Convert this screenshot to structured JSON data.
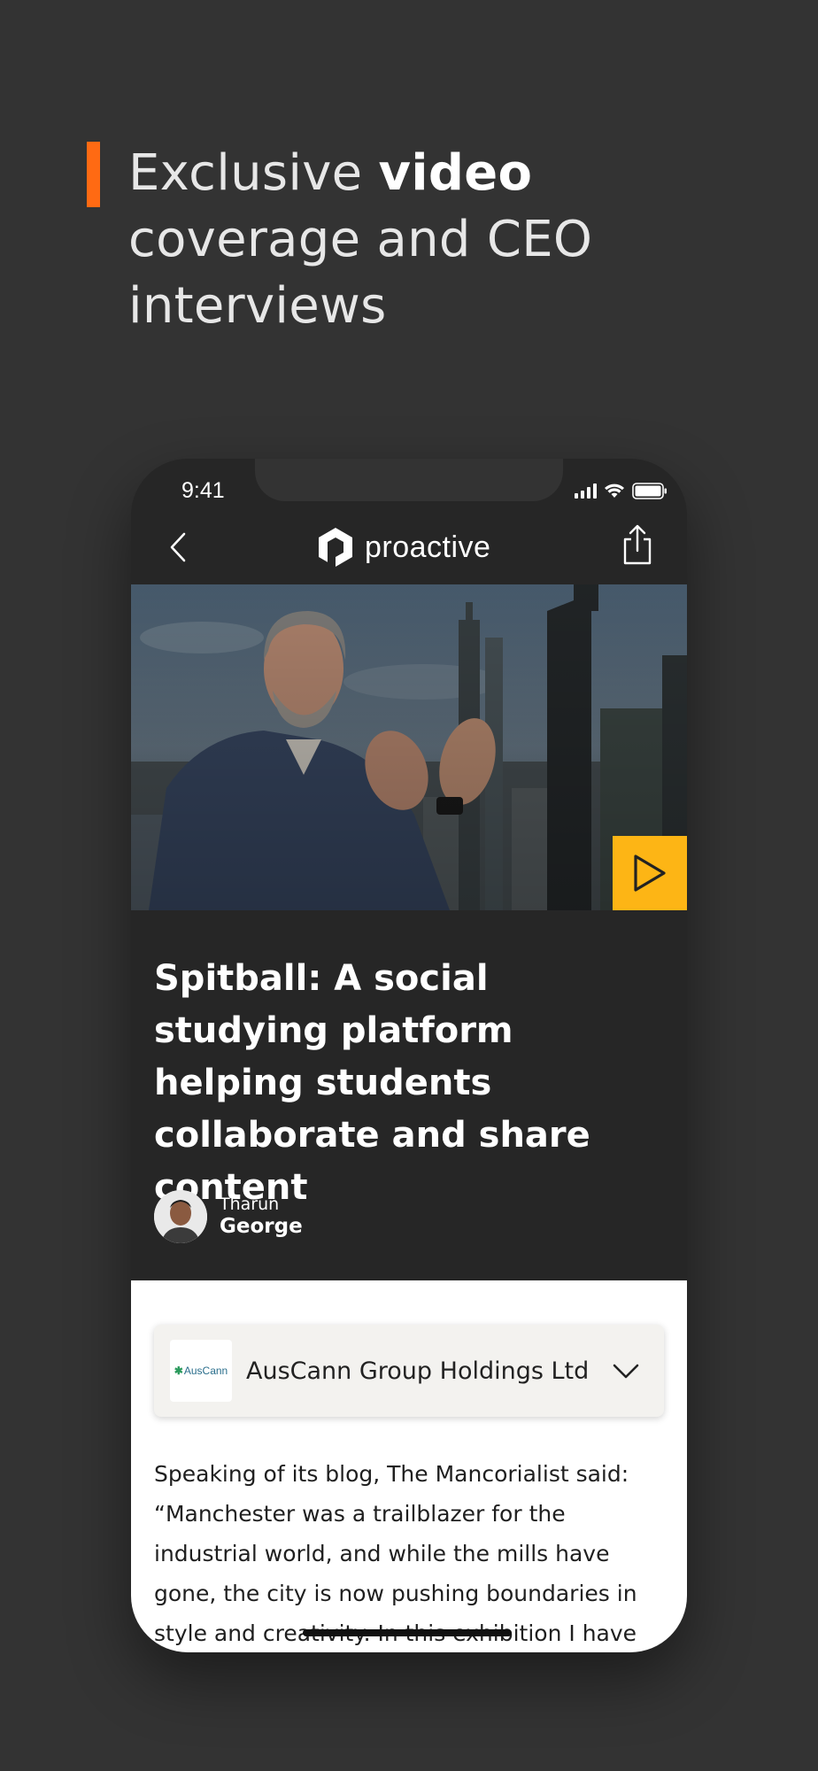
{
  "headline": {
    "part1": "Exclusive ",
    "bold": "video",
    "part2": " coverage and CEO interviews",
    "accent_color": "#ff6a13"
  },
  "status_bar": {
    "time": "9:41",
    "icons": [
      "signal-icon",
      "wifi-icon",
      "battery-icon"
    ]
  },
  "nav": {
    "back_icon": "chevron-left-icon",
    "logo_text": "proactive",
    "share_icon": "share-icon"
  },
  "video": {
    "play_icon": "play-icon",
    "play_color": "#fdb515"
  },
  "article": {
    "title": "Spitball: A social studying platform helping students collaborate and share content",
    "author_first": "Tharun",
    "author_last": "George"
  },
  "company": {
    "logo_text": "AusCann",
    "name": "AusCann Group Holdings Ltd",
    "dropdown_icon": "chevron-down-icon"
  },
  "body": {
    "text": "Speaking of its blog, The Mancorialist said: “Manchester was a trailblazer for the industrial world, and while the mills have gone, the city is now pushing boundaries in style and creativity. In this exhibition I have"
  }
}
